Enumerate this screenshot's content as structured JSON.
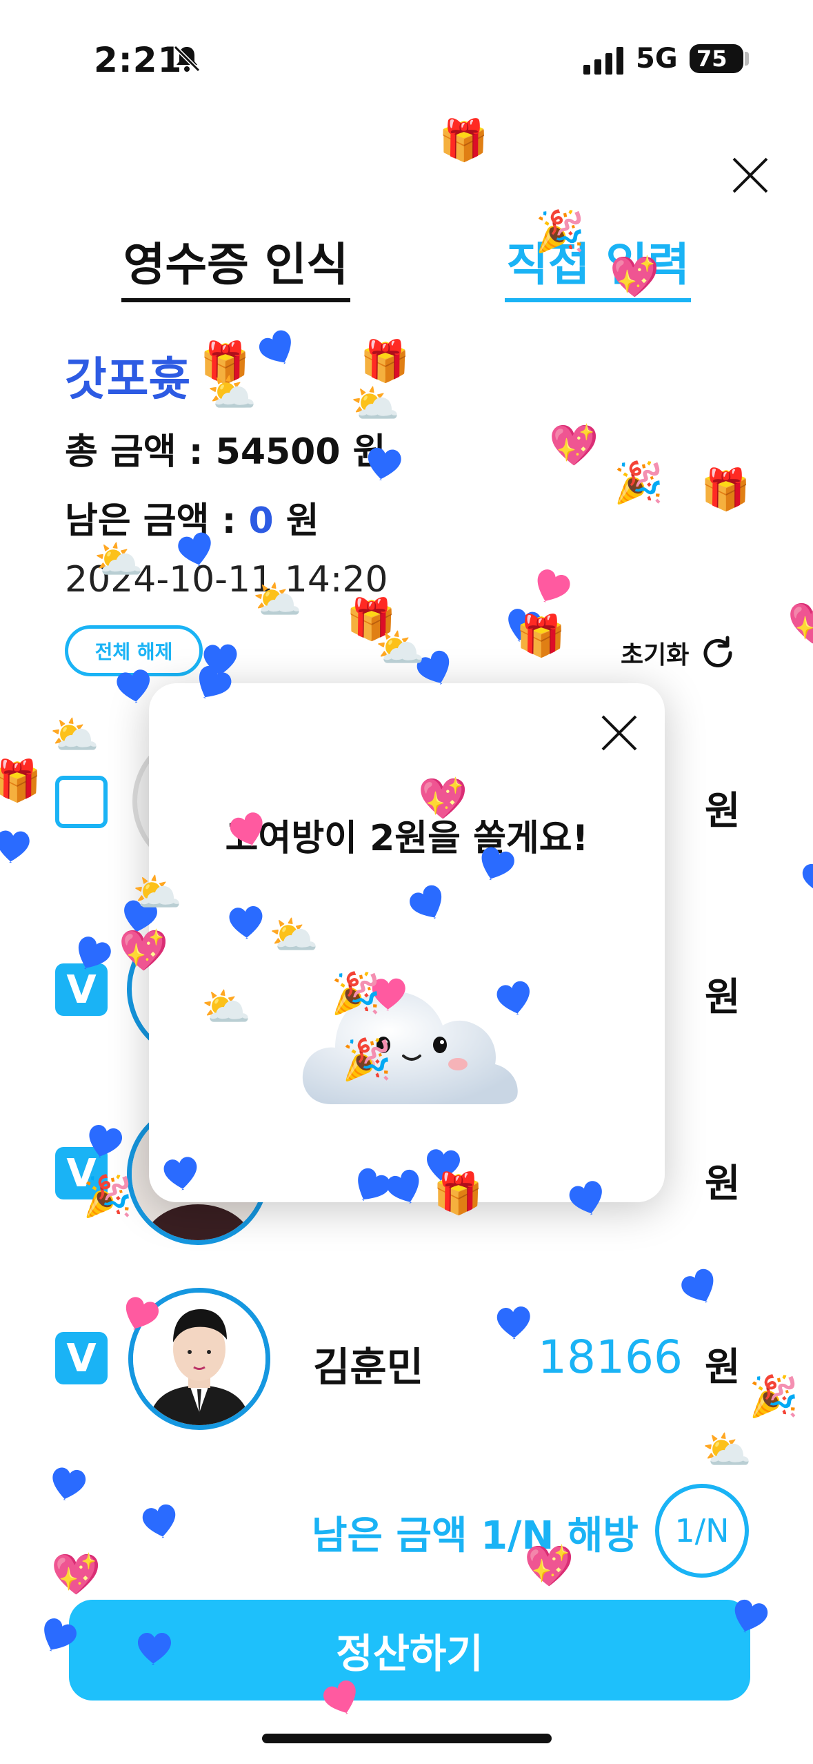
{
  "status_bar": {
    "time": "2:21",
    "network": "5G",
    "battery": "75"
  },
  "tabs": {
    "receipt": "영수증 인식",
    "manual": "직접 입력"
  },
  "store_name": "갓포흇",
  "total": {
    "label": "총 금액 : ",
    "value": "54500",
    "unit": " 원"
  },
  "remaining": {
    "label": "남은 금액 : ",
    "value": "0",
    "unit": " 원"
  },
  "datetime": "2024-10-11 14:20",
  "deselect_all": "전체 해제",
  "reset": "초기화",
  "rows": [
    {
      "checked": false,
      "check_label": "",
      "name": "",
      "amount": "",
      "unit": "원"
    },
    {
      "checked": true,
      "check_label": "V",
      "name": "",
      "amount": "",
      "unit": "원"
    },
    {
      "checked": true,
      "check_label": "V",
      "name": "",
      "amount": "",
      "unit": "원"
    },
    {
      "checked": true,
      "check_label": "V",
      "name": "김훈민",
      "amount": "18166",
      "unit": "원"
    }
  ],
  "remaining_split": "남은 금액 1/N 해방",
  "split_badge": "1/N",
  "settle_button": "정산하기",
  "modal": {
    "message": "고여방이 2원을 쏠게요!"
  },
  "colors": {
    "accent": "#1ab3f5",
    "store_blue": "#2d5be3",
    "button": "#1ec0fb"
  },
  "icons": [
    "close-icon",
    "bell-slash-icon",
    "signal-icon",
    "refresh-icon",
    "cloud-mascot-icon",
    "heart-icon",
    "gift-icon",
    "party-popper-icon"
  ]
}
